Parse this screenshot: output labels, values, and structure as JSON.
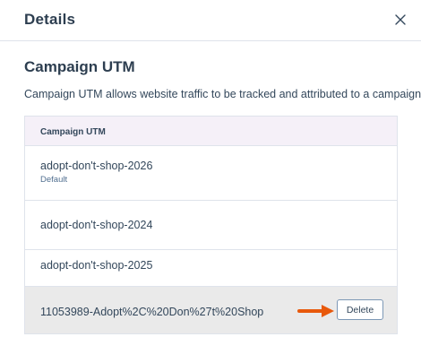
{
  "header": {
    "title": "Details",
    "close_icon": "close-icon"
  },
  "section": {
    "title": "Campaign UTM",
    "description": "Campaign UTM allows website traffic to be tracked and attributed to a campaign."
  },
  "table": {
    "column_header": "Campaign UTM",
    "rows": [
      {
        "value": "adopt-don't-shop-2026",
        "sub": "Default"
      },
      {
        "value": "adopt-don't-shop-2024"
      },
      {
        "value": "adopt-don't-shop-2025"
      },
      {
        "value": "11053989-Adopt%2C%20Don%27t%20Shop",
        "action_label": "Delete"
      }
    ]
  },
  "colors": {
    "header_bg": "#f5f0f8",
    "arrow": "#e8590c",
    "highlight_row": "#eaeaea",
    "text": "#33475b"
  }
}
